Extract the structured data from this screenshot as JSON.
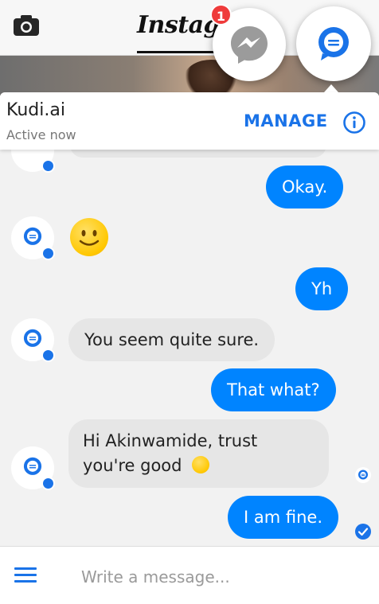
{
  "instagram": {
    "logo_text": "Instagr"
  },
  "chat_heads": {
    "messenger_badge": "1"
  },
  "header": {
    "contact_name": "Kudi.ai",
    "status": "Active now",
    "manage_label": "MANAGE"
  },
  "messages": {
    "m1": "Okay.",
    "m2": "Yh",
    "m3": "You seem quite sure.",
    "m4": "That what?",
    "m5_line1": "Hi Akinwamide, trust",
    "m5_line2": "you're good",
    "m6": "I am fine."
  },
  "composer": {
    "placeholder": "Write a message..."
  },
  "colors": {
    "accent": "#1a73e8",
    "outgoing": "#0084ff",
    "incoming": "#e6e6e6",
    "badge": "#ef3b3b"
  }
}
